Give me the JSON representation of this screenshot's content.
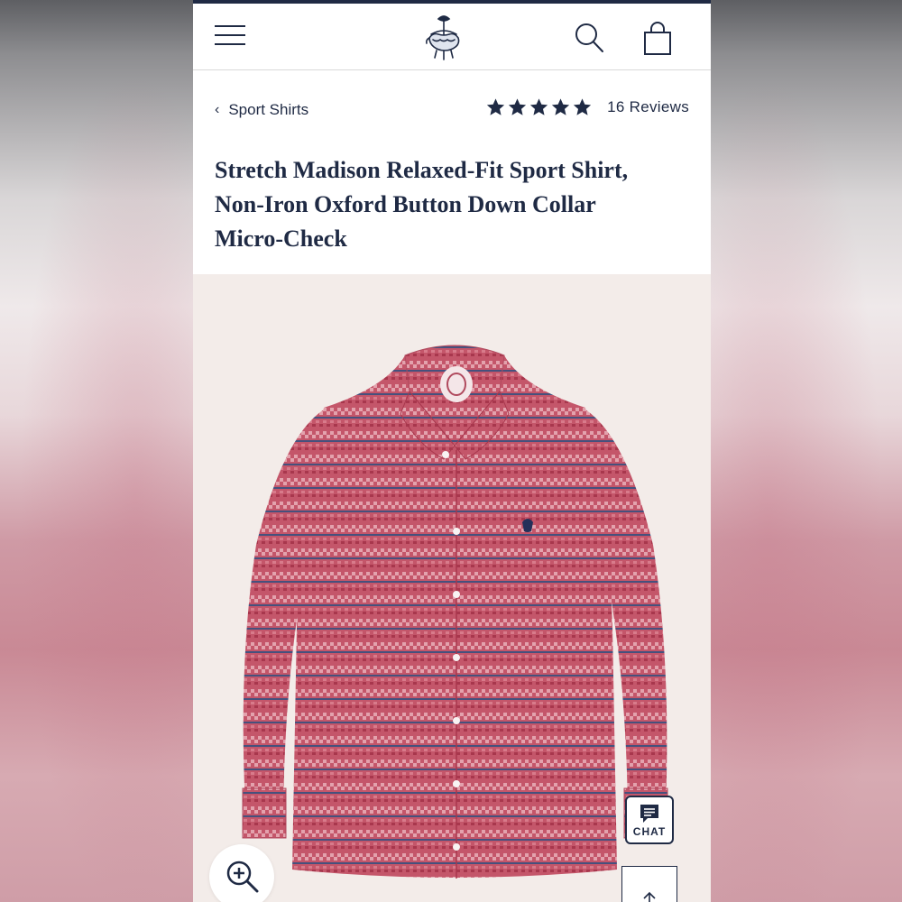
{
  "header": {
    "menu_icon": "hamburger-menu-icon",
    "logo_icon": "golden-fleece-logo-icon",
    "search_icon": "search-icon",
    "bag_icon": "shopping-bag-icon"
  },
  "breadcrumb": {
    "label": "Sport Shirts",
    "icon": "chevron-left-icon"
  },
  "rating": {
    "stars": 5,
    "max": 5,
    "reviews_label": "16 Reviews"
  },
  "product": {
    "title_line1": "Stretch Madison Relaxed-Fit Sport Shirt,",
    "title_line2": "Non-Iron Oxford Button Down Collar",
    "title_line3": "Micro-Check"
  },
  "actions": {
    "zoom_icon": "zoom-in-icon",
    "chat_label": "CHAT",
    "chat_icon": "chat-bubble-icon",
    "back_to_top_icon": "arrow-up-icon"
  },
  "colors": {
    "navy": "#1f2a44",
    "shirt_red": "#c4566a",
    "stripe_blue": "#46517d",
    "image_bg": "#f3ece9"
  }
}
